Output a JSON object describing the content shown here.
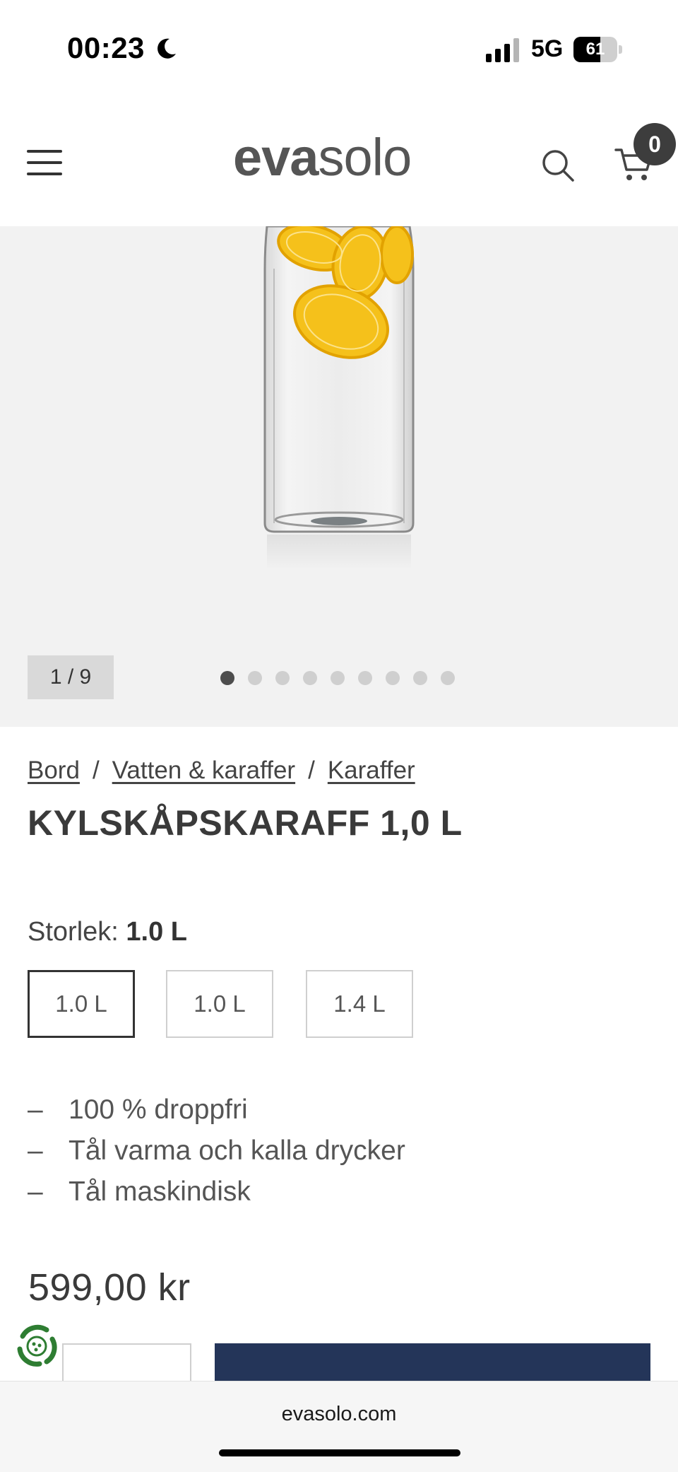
{
  "status_bar": {
    "time": "00:23",
    "network": "5G",
    "battery": "61",
    "battery_level": 0.61
  },
  "header": {
    "logo_part1": "eva",
    "logo_part2": "solo",
    "cart_count": "0"
  },
  "gallery": {
    "counter": "1 / 9",
    "total_images": 9,
    "active_index": 0
  },
  "breadcrumb": {
    "items": [
      "Bord",
      "Vatten & karaffer",
      "Karaffer"
    ],
    "separator": "/"
  },
  "product": {
    "title": "KYLSKÅPSKARAFF 1,0 L",
    "size_label": "Storlek:",
    "size_selected": "1.0 L",
    "sizes": [
      "1.0 L",
      "1.0 L",
      "1.4 L"
    ],
    "features": [
      "100 % droppfri",
      "Tål varma och kalla drycker",
      "Tål maskindisk"
    ],
    "feature_bullet": "–",
    "price": "599,00 kr"
  },
  "browser": {
    "url": "evasolo.com"
  },
  "colors": {
    "primary_button": "#243559",
    "badge": "#3d3d3d",
    "gallery_bg": "#f2f2f2"
  }
}
